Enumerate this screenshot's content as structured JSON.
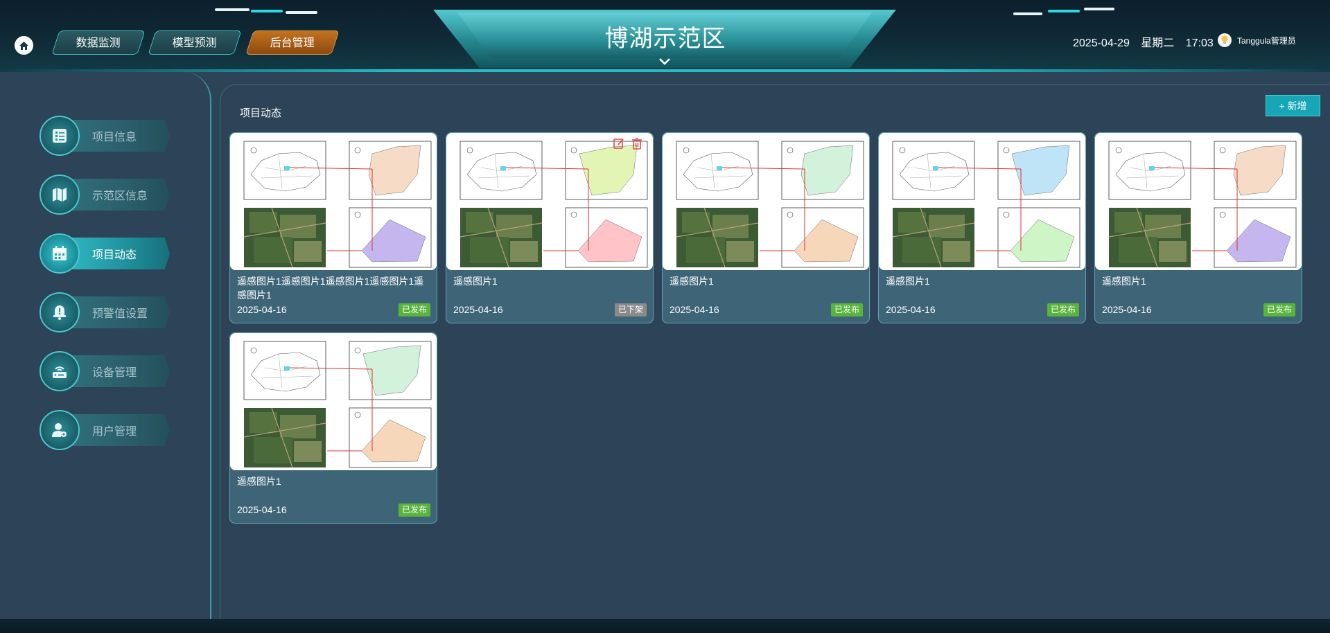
{
  "header": {
    "title": "博湖示范区",
    "nav": [
      "数据监测",
      "模型预测",
      "后台管理"
    ],
    "active_nav": "后台管理",
    "date": "2025-04-29",
    "weekday": "星期二",
    "time": "17:03",
    "user": "Tanggula管理员"
  },
  "sidebar": {
    "items": [
      {
        "label": "项目信息",
        "icon": "list-icon"
      },
      {
        "label": "示范区信息",
        "icon": "map-icon"
      },
      {
        "label": "项目动态",
        "icon": "calendar-icon",
        "active": true
      },
      {
        "label": "预警值设置",
        "icon": "bell-alert-icon"
      },
      {
        "label": "设备管理",
        "icon": "device-icon"
      },
      {
        "label": "用户管理",
        "icon": "user-gear-icon"
      }
    ]
  },
  "main": {
    "section_title": "项目动态",
    "add_button": "+ 新增",
    "cards": [
      {
        "title": "遥感图片1遥感图片1遥感图片1遥感图片1遥感图片1",
        "date": "2025-04-16",
        "status": "已发布",
        "polygon_color": "#c5b6f0",
        "top_right_color": "#f6dcc6"
      },
      {
        "title": "遥感图片1",
        "date": "2025-04-16",
        "status": "已下架",
        "polygon_color": "#ffc3c8",
        "top_right_color": "#e3f5b5"
      },
      {
        "title": "遥感图片1",
        "date": "2025-04-16",
        "status": "已发布",
        "polygon_color": "#f6d7b9",
        "top_right_color": "#d3f2dc"
      },
      {
        "title": "遥感图片1",
        "date": "2025-04-16",
        "status": "已发布",
        "polygon_color": "#cdf5c5",
        "top_right_color": "#bfe4f7"
      },
      {
        "title": "遥感图片1",
        "date": "2025-04-16",
        "status": "已发布",
        "polygon_color": "#c5b6f0",
        "top_right_color": "#f6dcc6"
      },
      {
        "title": "遥感图片1",
        "date": "2025-04-16",
        "status": "已发布",
        "polygon_color": "#f6d7b9",
        "top_right_color": "#d3f2dc"
      }
    ]
  },
  "colors": {
    "accent": "#17a6b6",
    "published": "#58b43c",
    "offline": "#8a8a8a",
    "active_nav": "#c0721e",
    "background": "#2d4357"
  }
}
